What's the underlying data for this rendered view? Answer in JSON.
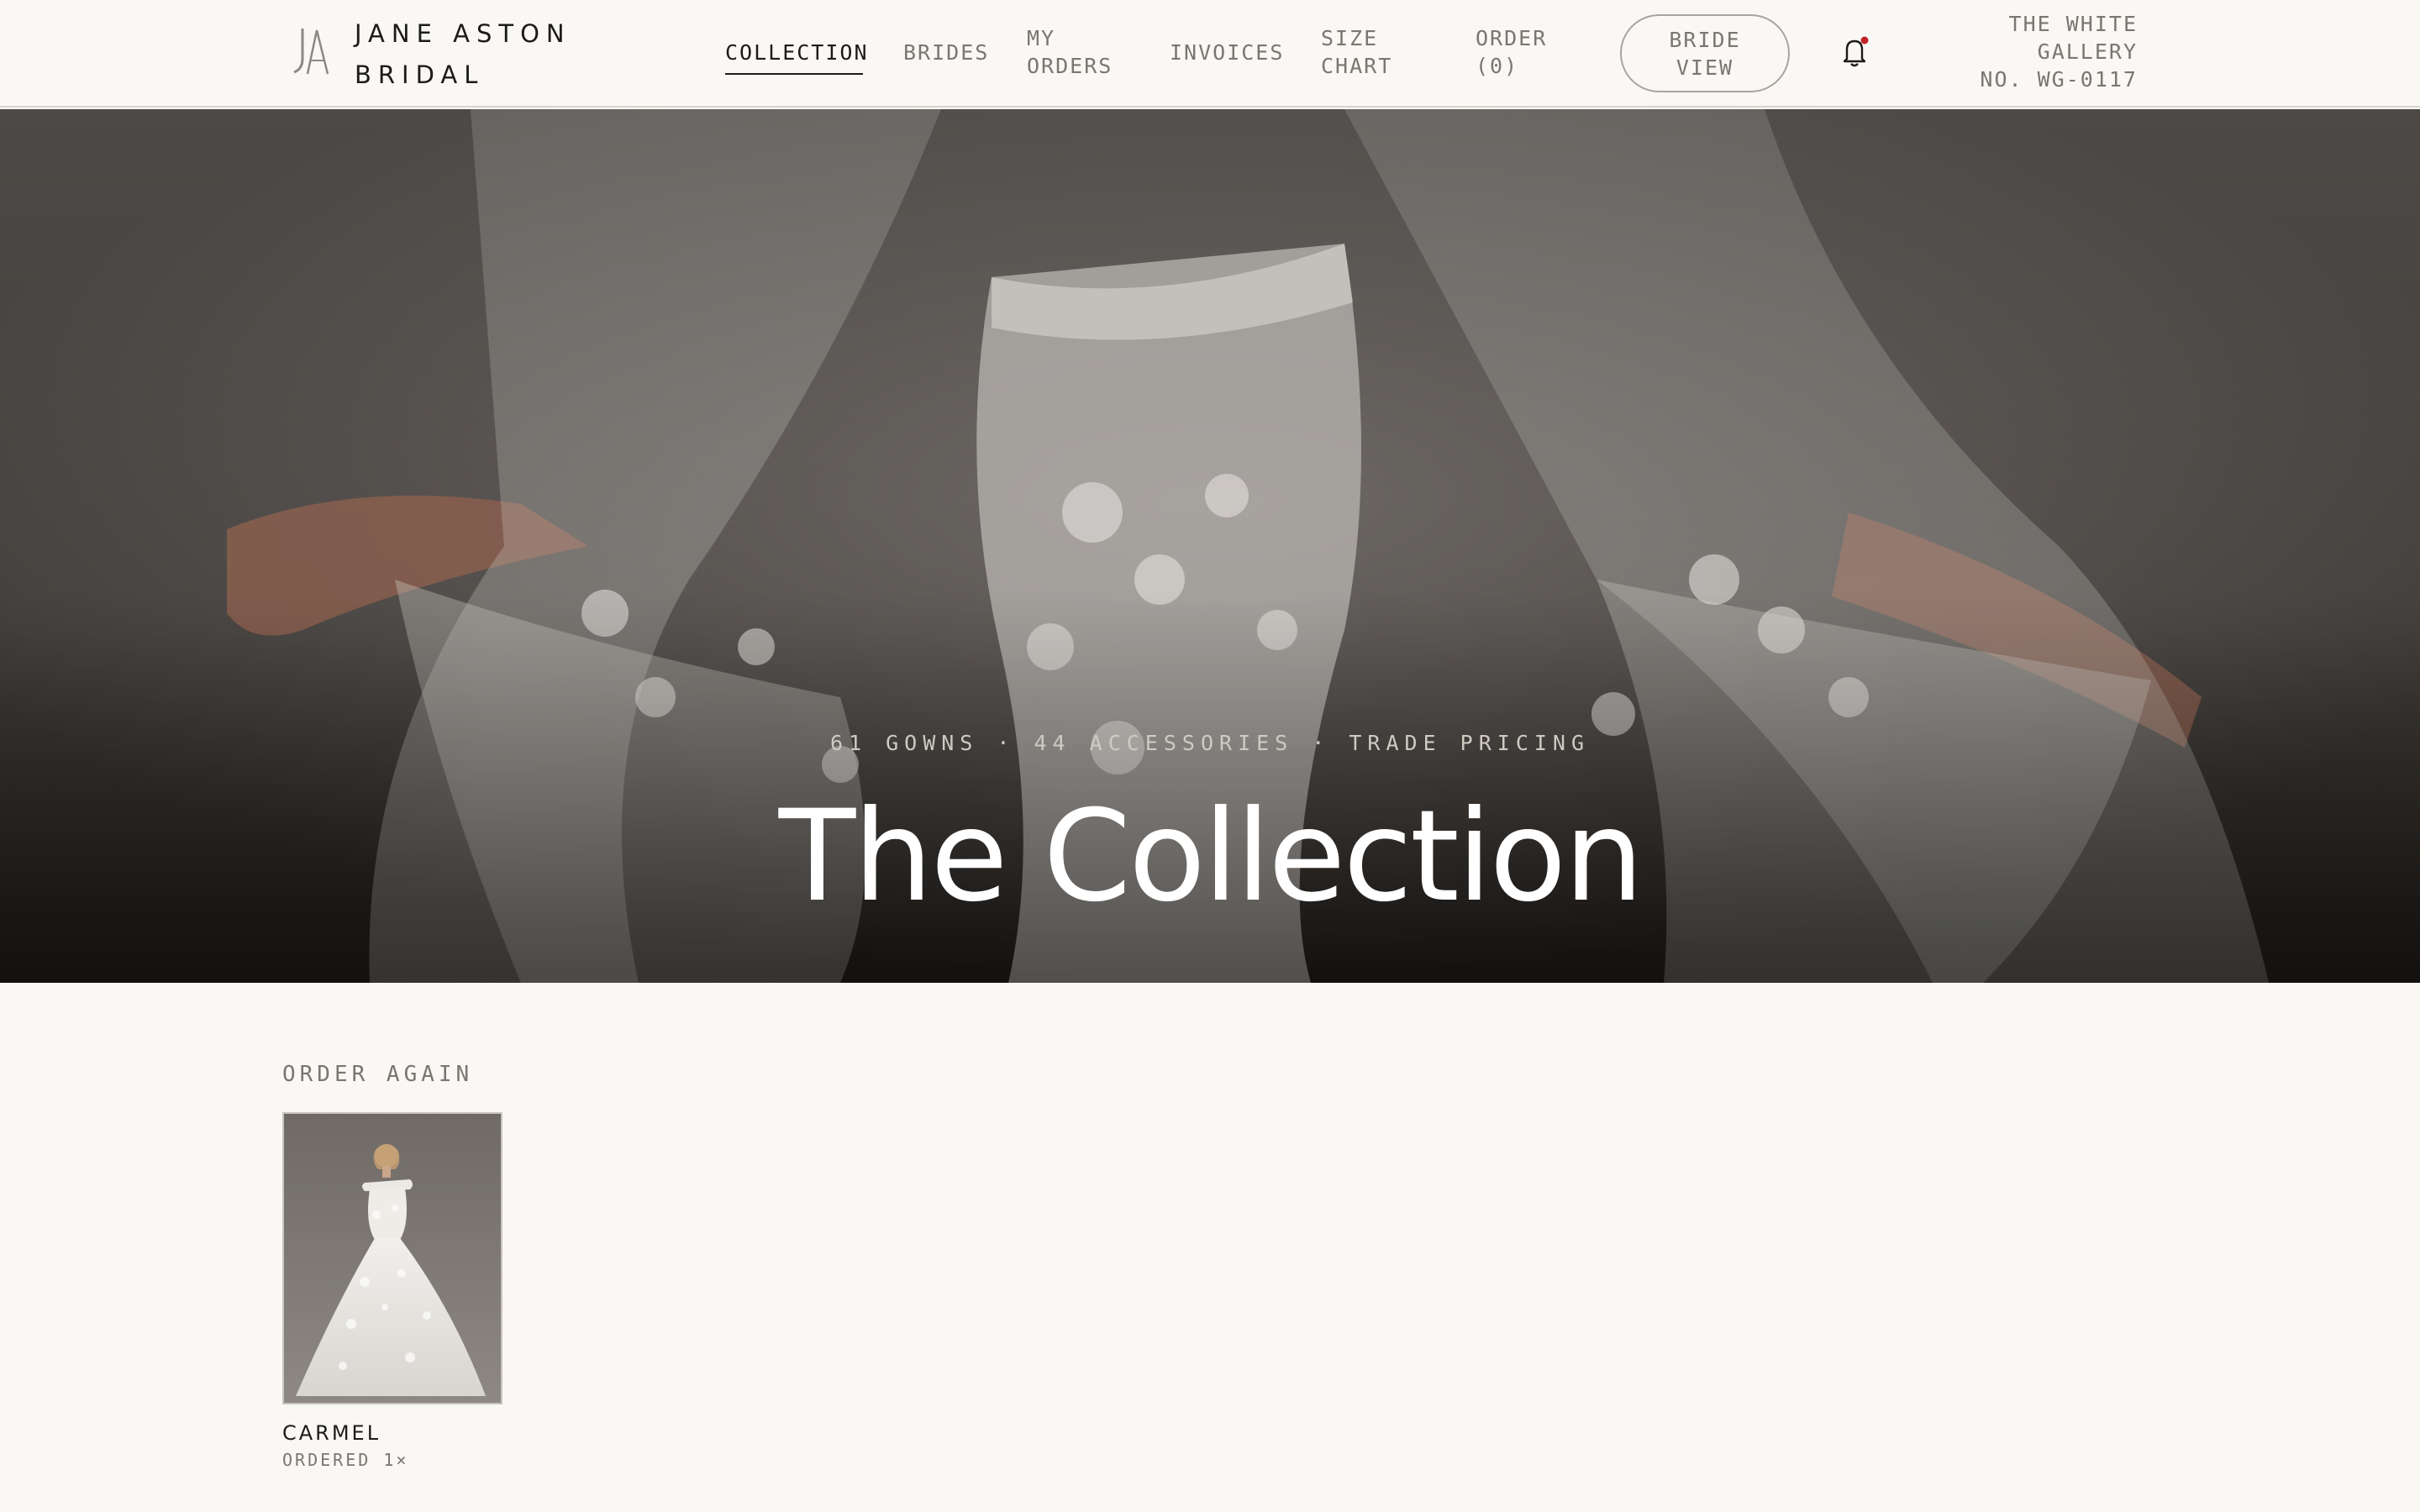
{
  "brand": {
    "line1": "JANE ASTON",
    "line2": "BRIDAL",
    "logo_icon": "ja-monogram-icon"
  },
  "nav": {
    "items": [
      {
        "label": "COLLECTION",
        "active": true
      },
      {
        "label": "BRIDES"
      },
      {
        "label": "MY\nORDERS"
      },
      {
        "label": "INVOICES"
      },
      {
        "label": "SIZE\nCHART"
      },
      {
        "label": "ORDER\n(0)"
      }
    ],
    "bride_view": "BRIDE\nVIEW",
    "bell_icon": "bell-icon",
    "has_notification": true
  },
  "account": {
    "name_line1": "THE WHITE",
    "name_line2": "GALLERY",
    "number": "NO. WG-0117"
  },
  "hero": {
    "meta": "61 GOWNS · 44 ACCESSORIES · TRADE PRICING",
    "title": "The Collection"
  },
  "order_again": {
    "label": "ORDER AGAIN",
    "items": [
      {
        "name": "CARMEL",
        "subtitle": "ORDERED 1×"
      }
    ]
  },
  "colors": {
    "background": "#f9f8f4",
    "text_dark": "#1d1b19",
    "text_muted": "#7a7670",
    "notification_dot": "#c0242b"
  }
}
